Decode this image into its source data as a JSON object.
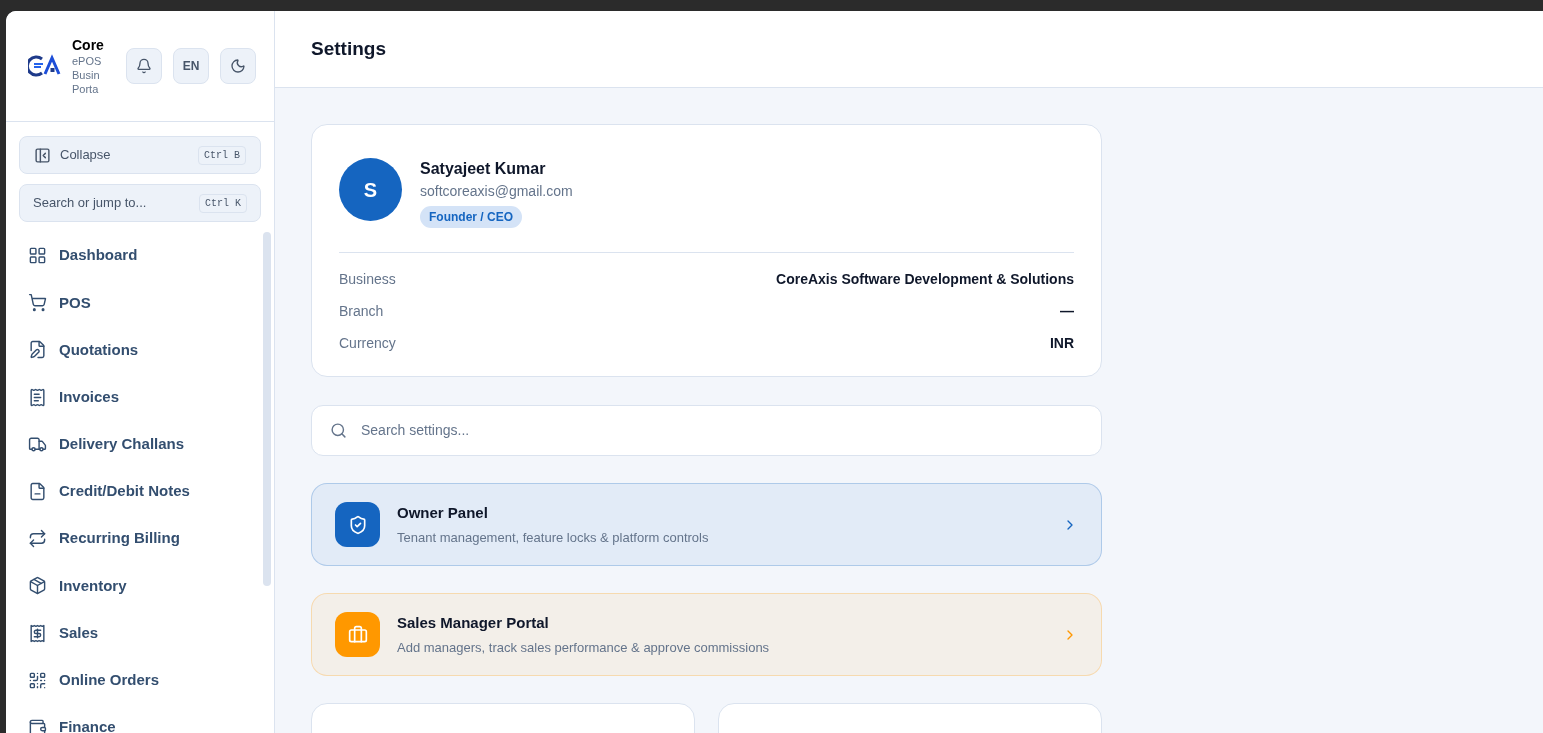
{
  "brand": {
    "name": "Core",
    "lines": [
      "ePOS",
      "Busin",
      "Porta"
    ]
  },
  "header_buttons": [
    {
      "kind": "bell"
    },
    {
      "kind": "text",
      "label": "EN"
    },
    {
      "kind": "moon"
    }
  ],
  "sidebar": {
    "collapse": {
      "label": "Collapse",
      "shortcut": "Ctrl B"
    },
    "search": {
      "placeholder": "Search or jump to...",
      "shortcut": "Ctrl K"
    },
    "items": [
      {
        "label": "Dashboard",
        "kind": "dashboard",
        "selected": false
      },
      {
        "label": "POS",
        "kind": "cart",
        "selected": false
      },
      {
        "label": "Quotations",
        "kind": "quote",
        "selected": false
      },
      {
        "label": "Invoices",
        "kind": "invoice",
        "selected": false
      },
      {
        "label": "Delivery Challans",
        "kind": "delivery",
        "selected": false
      },
      {
        "label": "Credit/Debit Notes",
        "kind": "note",
        "selected": false
      },
      {
        "label": "Recurring Billing",
        "kind": "recurring",
        "selected": false
      },
      {
        "label": "Inventory",
        "kind": "inventory",
        "selected": false
      },
      {
        "label": "Sales",
        "kind": "sales",
        "selected": false
      },
      {
        "label": "Online Orders",
        "kind": "orders",
        "selected": false
      },
      {
        "label": "Finance",
        "kind": "finance",
        "selected": false
      }
    ]
  },
  "page": {
    "title": "Settings"
  },
  "profile": {
    "initial": "S",
    "name": "Satyajeet Kumar",
    "email": "softcoreaxis@gmail.com",
    "role": "Founder / CEO",
    "details": [
      {
        "label": "Business",
        "value": "CoreAxis Software Development & Solutions"
      },
      {
        "label": "Branch",
        "value": "—"
      },
      {
        "label": "Currency",
        "value": "INR"
      }
    ]
  },
  "settings_search": {
    "placeholder": "Search settings..."
  },
  "panels": [
    {
      "title": "Owner Panel",
      "description": "Tenant management, feature locks & platform controls",
      "kind": "owner",
      "color": "#1565c0"
    },
    {
      "title": "Sales Manager Portal",
      "description": "Add managers, track sales performance & approve commissions",
      "kind": "sales",
      "color": "#ff9800"
    }
  ]
}
